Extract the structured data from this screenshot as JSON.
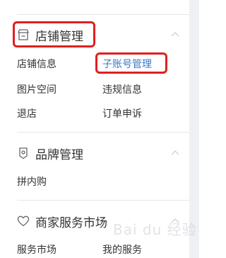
{
  "sections": [
    {
      "title": "店铺管理",
      "icon": "store-icon",
      "items": [
        "店铺信息",
        "子账号管理",
        "图片空间",
        "违规信息",
        "退店",
        "订单申诉"
      ],
      "active_item": "子账号管理"
    },
    {
      "title": "品牌管理",
      "icon": "brand-tag-icon",
      "items": [
        "拼内购"
      ]
    },
    {
      "title": "商家服务市场",
      "icon": "heart-icon",
      "items": [
        "服务市场",
        "我的服务"
      ]
    }
  ],
  "colors": {
    "active": "#3a77c9",
    "highlight_box": "#e02020"
  },
  "watermark": "Bai du 经验"
}
